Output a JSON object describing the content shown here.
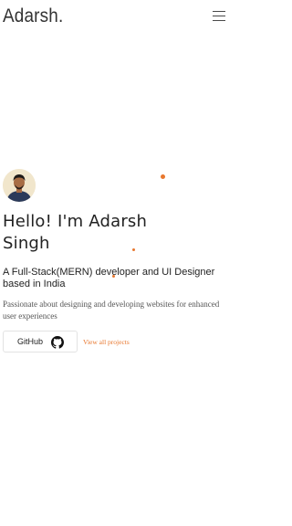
{
  "header": {
    "logo_text": "Adarsh.",
    "menu_icon": "hamburger-menu-icon"
  },
  "hero": {
    "avatar_icon": "profile-avatar",
    "greeting": "Hello! I'm Adarsh Singh",
    "subtitle": "A Full-Stack(MERN) developer and UI Designer based in India",
    "description": "Passionate about designing and developing websites for enhanced user experiences",
    "github_label": "GitHub",
    "github_icon": "github-icon",
    "view_projects_label": "View all projects"
  },
  "colors": {
    "accent": "#e8772e",
    "text": "#222222",
    "muted": "#555555",
    "background": "#ffffff"
  }
}
